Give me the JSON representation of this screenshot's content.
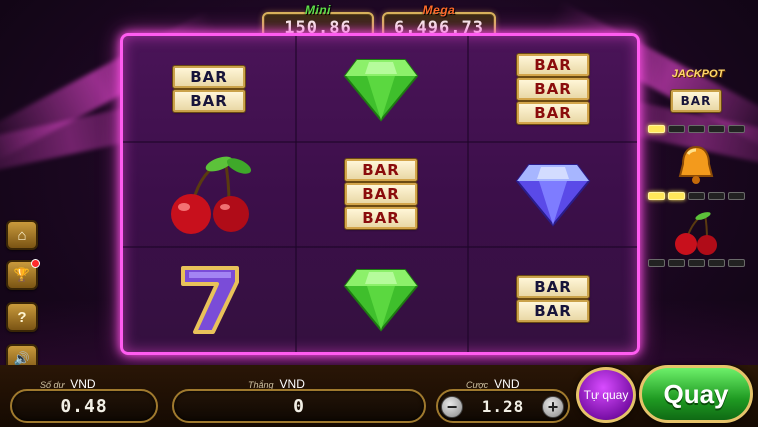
{
  "colors": {
    "frame_neon": "#ff5cf0",
    "spin_green": "#1f9a22",
    "auto_purple": "#a020d0",
    "gold_border": "#d7b35a"
  },
  "jackpots": {
    "mini": {
      "label": "Mini",
      "value": "150.86"
    },
    "mega": {
      "label": "Mega",
      "value": "6.496.73"
    }
  },
  "reels": {
    "grid": [
      [
        {
          "symbol": "bar-double",
          "bars": [
            "BAR",
            "BAR"
          ]
        },
        {
          "symbol": "green-diamond"
        },
        {
          "symbol": "bar-triple-red",
          "bars": [
            "BAR",
            "BAR",
            "BAR"
          ]
        }
      ],
      [
        {
          "symbol": "cherries"
        },
        {
          "symbol": "bar-triple-red",
          "bars": [
            "BAR",
            "BAR",
            "BAR"
          ]
        },
        {
          "symbol": "blue-diamond"
        }
      ],
      [
        {
          "symbol": "seven"
        },
        {
          "symbol": "green-diamond"
        },
        {
          "symbol": "bar-double",
          "bars": [
            "BAR",
            "BAR"
          ]
        }
      ]
    ]
  },
  "jackpot_panel": {
    "title": "JACKPOT",
    "items": [
      {
        "symbol": "bar",
        "label": "BAR",
        "progress": "1/5"
      },
      {
        "symbol": "bell-icon",
        "progress": "2/5"
      },
      {
        "symbol": "cherries-icon",
        "progress": "0/5"
      }
    ]
  },
  "side_menu": [
    {
      "name": "home-icon",
      "glyph": "⌂"
    },
    {
      "name": "trophy-icon",
      "glyph": "🏆"
    },
    {
      "name": "help-icon",
      "glyph": "?"
    },
    {
      "name": "sound-icon",
      "glyph": "🔊"
    }
  ],
  "bottom": {
    "balance": {
      "label": "Số dư",
      "currency": "VND",
      "value": "0.48"
    },
    "win": {
      "label": "Thắng",
      "currency": "VND",
      "value": "0"
    },
    "bet": {
      "label": "Cược",
      "currency": "VND",
      "value": "1.28",
      "minus": "−",
      "plus": "+"
    },
    "auto_label": "Tự quay",
    "spin_label": "Quay"
  }
}
